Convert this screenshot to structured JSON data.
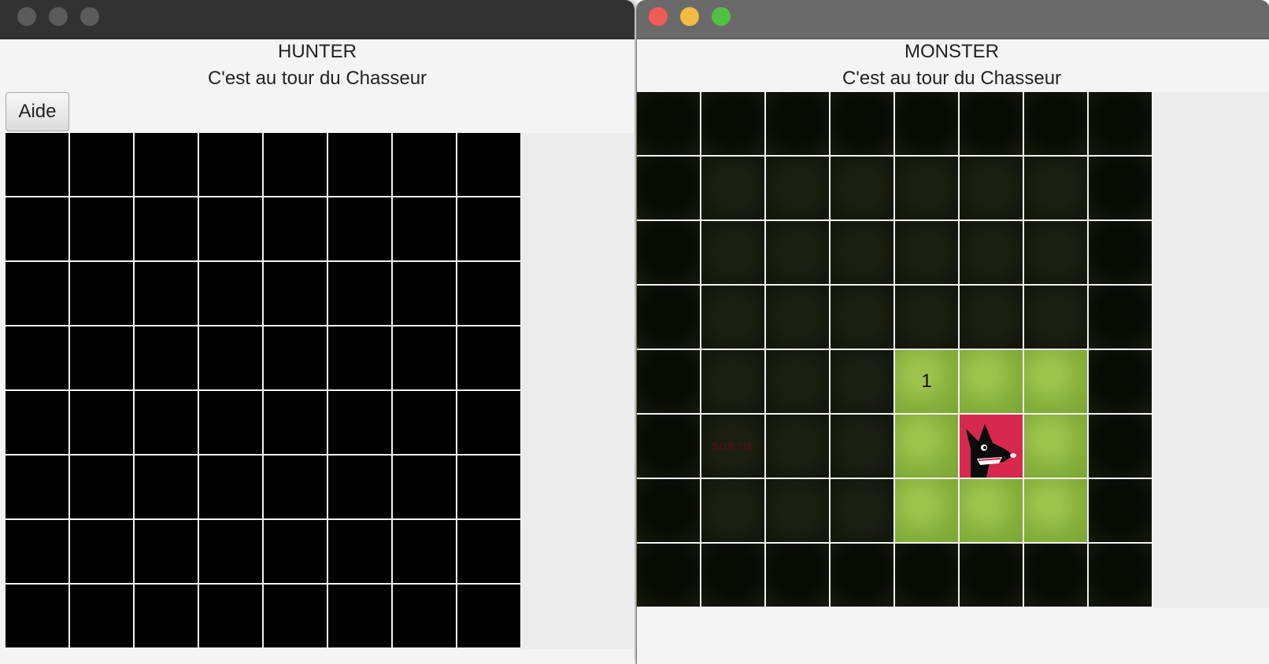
{
  "hunter_window": {
    "title": "HUNTER",
    "status": "C'est au tour du Chasseur",
    "help_button": "Aide"
  },
  "monster_window": {
    "title": "MONSTER",
    "status": "C'est au tour du Chasseur"
  },
  "hunter_grid": {
    "rows": 8,
    "cols": 8,
    "cells": [
      [
        "unknown",
        "unknown",
        "unknown",
        "unknown",
        "unknown",
        "unknown",
        "unknown",
        "unknown"
      ],
      [
        "unknown",
        "unknown",
        "unknown",
        "unknown",
        "unknown",
        "unknown",
        "unknown",
        "unknown"
      ],
      [
        "unknown",
        "unknown",
        "unknown",
        "unknown",
        "unknown",
        "unknown",
        "unknown",
        "unknown"
      ],
      [
        "unknown",
        "unknown",
        "unknown",
        "unknown",
        "unknown",
        "unknown",
        "unknown",
        "unknown"
      ],
      [
        "unknown",
        "unknown",
        "unknown",
        "unknown",
        "unknown",
        "unknown",
        "unknown",
        "unknown"
      ],
      [
        "unknown",
        "unknown",
        "unknown",
        "unknown",
        "unknown",
        "unknown",
        "unknown",
        "unknown"
      ],
      [
        "unknown",
        "unknown",
        "unknown",
        "unknown",
        "unknown",
        "unknown",
        "unknown",
        "unknown"
      ],
      [
        "unknown",
        "unknown",
        "unknown",
        "unknown",
        "unknown",
        "unknown",
        "unknown",
        "unknown"
      ]
    ]
  },
  "monster_grid": {
    "rows": 8,
    "cols": 8,
    "exit_label": "SORTIE",
    "visited_number": "1",
    "cells": [
      [
        "wall",
        "wall",
        "wall",
        "wall",
        "wall",
        "wall",
        "wall",
        "wall"
      ],
      [
        "wall",
        "floor",
        "floor",
        "floor",
        "floor",
        "floor",
        "floor",
        "wall"
      ],
      [
        "wall",
        "floor",
        "floor",
        "floor",
        "floor",
        "floor",
        "floor",
        "wall"
      ],
      [
        "wall",
        "floor",
        "floor",
        "floor",
        "floor",
        "floor",
        "floor",
        "wall"
      ],
      [
        "wall",
        "floor",
        "floor",
        "floor",
        "grass-1",
        "grass",
        "grass",
        "wall"
      ],
      [
        "wall",
        "exit",
        "floor",
        "floor",
        "grass",
        "monster",
        "grass",
        "wall"
      ],
      [
        "wall",
        "floor",
        "floor",
        "floor",
        "grass",
        "grass",
        "grass",
        "wall"
      ],
      [
        "wall",
        "wall",
        "wall",
        "wall",
        "wall",
        "wall",
        "wall",
        "wall"
      ]
    ]
  }
}
